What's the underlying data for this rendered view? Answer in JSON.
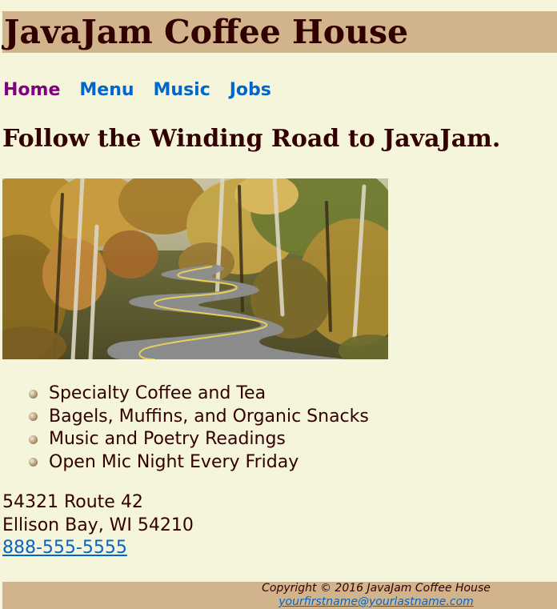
{
  "header": {
    "title": "JavaJam Coffee House"
  },
  "nav": {
    "items": [
      {
        "label": "Home"
      },
      {
        "label": "Menu"
      },
      {
        "label": "Music"
      },
      {
        "label": "Jobs"
      }
    ]
  },
  "main": {
    "headline": "Follow the Winding Road to JavaJam.",
    "features": [
      "Specialty Coffee and Tea",
      "Bagels, Muffins, and Organic Snacks",
      "Music and Poetry Readings",
      "Open Mic Night Every Friday"
    ],
    "address": {
      "street": "54321 Route 42",
      "city_line": "Ellison Bay, WI 54210",
      "phone": "888-555-5555"
    }
  },
  "footer": {
    "copyright": "Copyright © 2016 JavaJam Coffee House",
    "email": "yourfirstname@yourlastname.com"
  },
  "colors": {
    "page_background": "#f5f5dc",
    "banner": "#d2b48c",
    "text": "#330000",
    "link": "#0066cc",
    "visited_link": "#800080"
  }
}
